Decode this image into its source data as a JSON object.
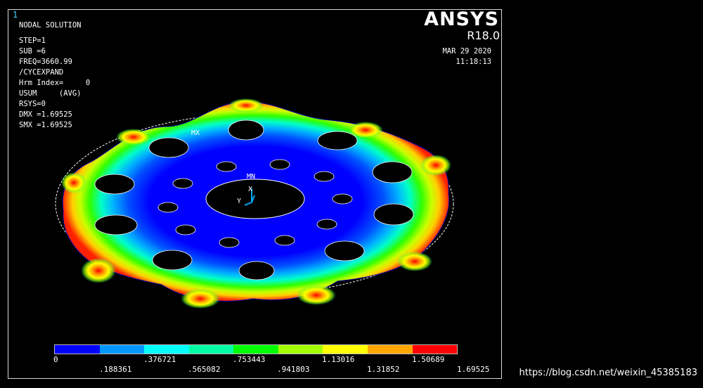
{
  "window_number": "1",
  "info_lines": [
    "NODAL SOLUTION",
    "STEP=1",
    "SUB =6",
    "FREQ=3660.99",
    "/CYCEXPAND",
    "Hrm Index=     0",
    "USUM     (AVG)",
    "RSYS=0",
    "DMX =1.69525",
    "SMX =1.69525"
  ],
  "brand": "ANSYS",
  "release": "R18.0",
  "date": "MAR 29 2020",
  "time": "11:18:13",
  "labels": {
    "max": "MX",
    "min": "MN",
    "axis_x": "X",
    "axis_y": "Y"
  },
  "legend": {
    "colors": [
      "#0000ff",
      "#0098ff",
      "#00ffff",
      "#00ffa6",
      "#00ff00",
      "#a6ff00",
      "#ffff00",
      "#ffa600",
      "#ff0000"
    ],
    "top_ticks": [
      "0",
      ".376721",
      ".753443",
      "1.13016",
      "1.50689"
    ],
    "bottom_ticks": [
      ".188361",
      ".565082",
      ".941803",
      "1.31852",
      "1.69525"
    ]
  },
  "watermark": "https://blog.csdn.net/weixin_45385183"
}
